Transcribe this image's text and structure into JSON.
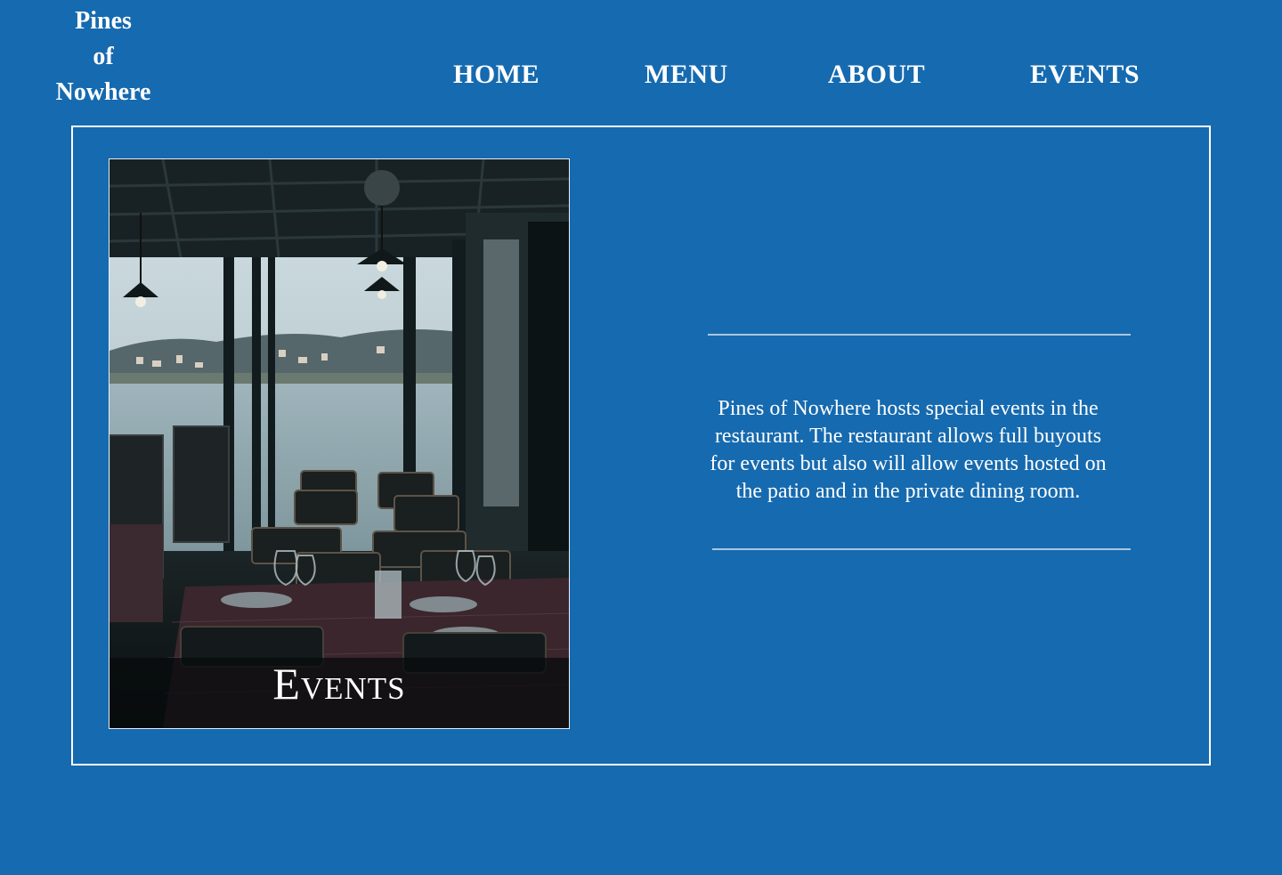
{
  "brand": {
    "line1": "Pines",
    "line2": "of",
    "line3": "Nowhere"
  },
  "nav": {
    "items": [
      {
        "label": "HOME"
      },
      {
        "label": "MENU"
      },
      {
        "label": "ABOUT"
      },
      {
        "label": "EVENTS"
      }
    ]
  },
  "hero": {
    "image_icon": "restaurant-photo",
    "caption": "Events",
    "description": "Pines of Nowhere hosts special events in the restaurant. The restaurant allows full buyouts for events but also will allow events hosted on the patio and in the private dining room."
  },
  "colors": {
    "background": "#166aaf",
    "text": "#ffffff",
    "rule": "#a9c6e0"
  }
}
